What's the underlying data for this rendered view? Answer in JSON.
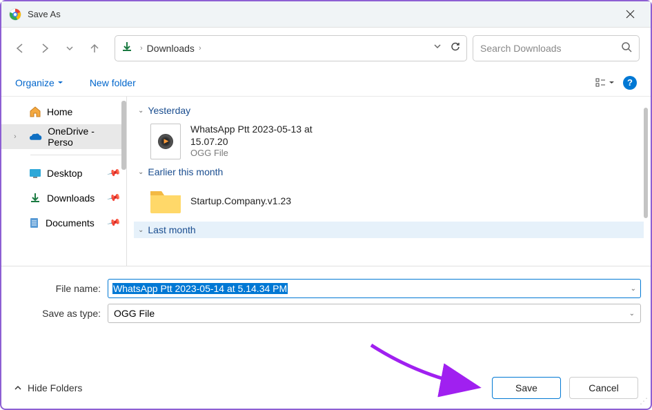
{
  "title": "Save As",
  "nav": {
    "location": "Downloads"
  },
  "search": {
    "placeholder": "Search Downloads"
  },
  "commands": {
    "organize": "Organize",
    "newfolder": "New folder"
  },
  "sidebar": {
    "home": "Home",
    "onedrive": "OneDrive - Perso",
    "desktop": "Desktop",
    "downloads": "Downloads",
    "documents": "Documents"
  },
  "groups": {
    "yesterday": "Yesterday",
    "earlier": "Earlier this month",
    "lastmonth": "Last month"
  },
  "files": {
    "ptt": {
      "name_line1": "WhatsApp Ptt 2023-05-13 at",
      "name_line2": "15.07.20",
      "type": "OGG File"
    },
    "startup": {
      "name": "Startup.Company.v1.23"
    }
  },
  "form": {
    "filename_label": "File name:",
    "filename_value": "WhatsApp Ptt 2023-05-14 at 5.14.34 PM",
    "savetype_label": "Save as type:",
    "savetype_value": "OGG File"
  },
  "footer": {
    "hidefolders": "Hide Folders",
    "save": "Save",
    "cancel": "Cancel"
  }
}
